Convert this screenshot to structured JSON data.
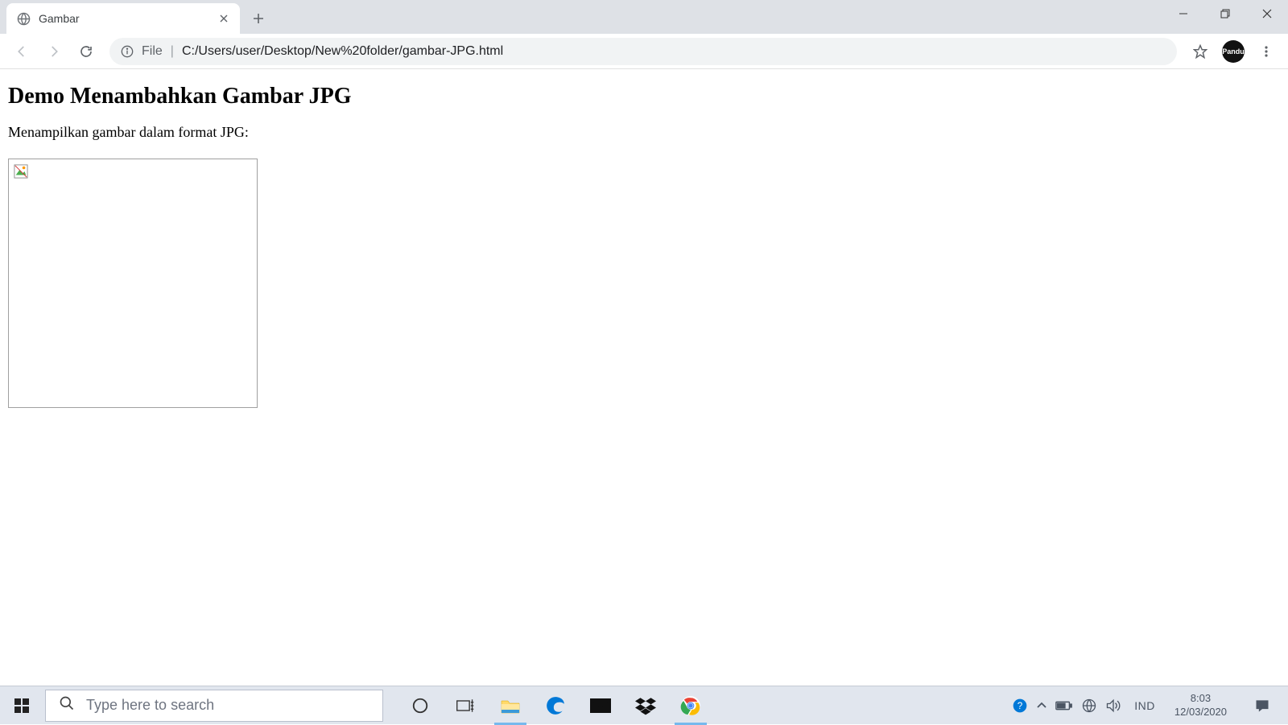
{
  "browser": {
    "tab_title": "Gambar",
    "file_label": "File",
    "url": "C:/Users/user/Desktop/New%20folder/gambar-JPG.html",
    "profile_label": "Pandu"
  },
  "page": {
    "heading": "Demo Menambahkan Gambar JPG",
    "paragraph": "Menampilkan gambar dalam format JPG:"
  },
  "taskbar": {
    "search_placeholder": "Type here to search",
    "language": "IND",
    "time": "8:03",
    "date": "12/03/2020"
  }
}
